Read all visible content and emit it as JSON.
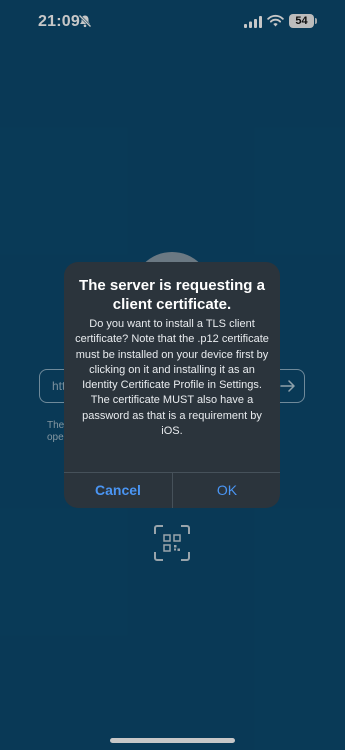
{
  "status_bar": {
    "time": "21:09",
    "battery": "54"
  },
  "background_app": {
    "url_placeholder": "htt",
    "hint_line1": "The",
    "hint_line2": "ope"
  },
  "alert": {
    "title": "The server is requesting a client certificate.",
    "message": "Do you want to install a TLS client certificate? Note that the .p12 certificate must be installed on your device first by clicking on it and installing it as an Identity Certificate Profile in Settings. The certificate MUST also have a password as that is a requirement by iOS.",
    "cancel_label": "Cancel",
    "ok_label": "OK"
  },
  "colors": {
    "background": "#0c4a6f",
    "alert_background": "#2b343c",
    "button_blue": "#4a95f3"
  }
}
